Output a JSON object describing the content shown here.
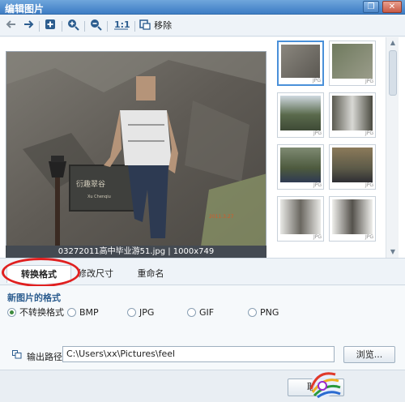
{
  "window": {
    "title": "编辑图片",
    "maximize_glyph": "❐",
    "close_glyph": "✕"
  },
  "toolbar": {
    "remove_label": "移除"
  },
  "photo": {
    "caption": "03272011高中毕业游51.jpg | 1000x749"
  },
  "thumbnails": [
    {
      "badge": "JPG",
      "selected": true
    },
    {
      "badge": "JPG",
      "selected": false
    },
    {
      "badge": "JPG",
      "selected": false
    },
    {
      "badge": "JPG",
      "selected": false
    },
    {
      "badge": "JPG",
      "selected": false
    },
    {
      "badge": "JPG",
      "selected": false
    },
    {
      "badge": "JPG",
      "selected": false
    },
    {
      "badge": "JPG",
      "selected": false
    }
  ],
  "tabs": [
    {
      "label": "转换格式",
      "active": true
    },
    {
      "label": "修改尺寸",
      "active": false
    },
    {
      "label": "重命名",
      "active": false
    }
  ],
  "format": {
    "section_title": "新图片的格式",
    "options": [
      {
        "label": "不转换格式",
        "checked": true
      },
      {
        "label": "BMP",
        "checked": false
      },
      {
        "label": "JPG",
        "checked": false
      },
      {
        "label": "GIF",
        "checked": false
      },
      {
        "label": "PNG",
        "checked": false
      }
    ]
  },
  "output": {
    "label": "输出路径",
    "path": "C:\\Users\\xx\\Pictures\\feel",
    "browse_label": "浏览..."
  },
  "footer": {
    "cancel_label": "取消"
  }
}
